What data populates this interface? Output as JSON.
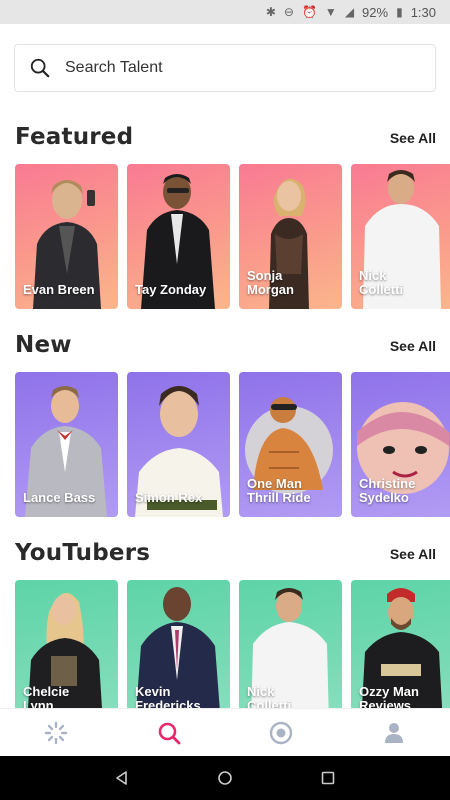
{
  "status_bar": {
    "battery": "92%",
    "time": "1:30"
  },
  "search": {
    "placeholder": "Search Talent"
  },
  "sections": [
    {
      "title": "Featured",
      "see_all": "See All",
      "cards": [
        {
          "name": "Evan Breen"
        },
        {
          "name": "Tay Zonday"
        },
        {
          "name": "Sonja\nMorgan"
        },
        {
          "name": "Nick\nColletti"
        }
      ]
    },
    {
      "title": "New",
      "see_all": "See All",
      "cards": [
        {
          "name": "Lance Bass"
        },
        {
          "name": "Simon Rex"
        },
        {
          "name": "One Man\nThrill Ride"
        },
        {
          "name": "Christine\nSydelko"
        }
      ]
    },
    {
      "title": "YouTubers",
      "see_all": "See All",
      "cards": [
        {
          "name": "Chelcie\nLynn"
        },
        {
          "name": "Kevin\nFredericks"
        },
        {
          "name": "Nick\nColletti"
        },
        {
          "name": "Ozzy Man\nReviews"
        }
      ]
    }
  ],
  "bottom_nav": [
    {
      "icon": "loading-spinner-icon",
      "active": false
    },
    {
      "icon": "search-icon",
      "active": true
    },
    {
      "icon": "record-target-icon",
      "active": false
    },
    {
      "icon": "profile-icon",
      "active": false
    }
  ],
  "colors": {
    "accent": "#e8286d",
    "featured_gradient": [
      "#f97a93",
      "#fbb68c"
    ],
    "new_gradient": [
      "#8f72ea",
      "#b19cf3"
    ],
    "youtubers_gradient": [
      "#5ed4a8",
      "#8edfc1"
    ]
  }
}
